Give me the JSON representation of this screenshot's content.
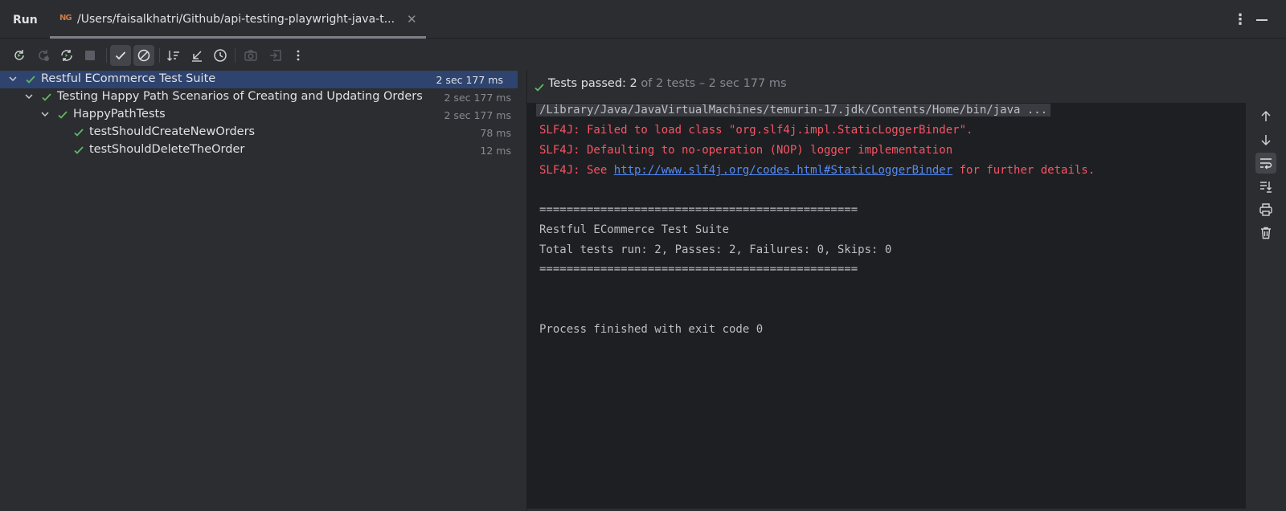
{
  "window": {
    "panel_title": "Run",
    "tab_title": "/Users/faisalkhatri/Github/api-testing-playwright-java-t...",
    "tab_icon_text": "NG"
  },
  "toolbar": {
    "buttons": [
      {
        "name": "rerun-icon"
      },
      {
        "name": "rerun-failed-icon"
      },
      {
        "name": "toggle-auto-test-icon"
      },
      {
        "name": "stop-icon"
      },
      {
        "name": "show-passed-icon",
        "active": true
      },
      {
        "name": "show-ignored-icon",
        "active": true
      },
      {
        "name": "sort-alphabetically-icon"
      },
      {
        "name": "collapse-all-icon"
      },
      {
        "name": "test-history-icon"
      },
      {
        "name": "camera-icon"
      },
      {
        "name": "import-tests-icon"
      },
      {
        "name": "more-options-icon"
      }
    ]
  },
  "tree": {
    "rows": [
      {
        "label": "Restful ECommerce Test Suite",
        "time": "2 sec 177 ms",
        "level": 0,
        "expandable": true,
        "selected": true
      },
      {
        "label": "Testing Happy Path Scenarios of Creating and Updating Orders",
        "time": "2 sec 177 ms",
        "level": 1,
        "expandable": true
      },
      {
        "label": "HappyPathTests",
        "time": "2 sec 177 ms",
        "level": 2,
        "expandable": true
      },
      {
        "label": "testShouldCreateNewOrders",
        "time": "78 ms",
        "level": 3,
        "expandable": false
      },
      {
        "label": "testShouldDeleteTheOrder",
        "time": "12 ms",
        "level": 3,
        "expandable": false
      }
    ]
  },
  "status": {
    "prefix": "Tests passed: ",
    "passed": "2",
    "suffix": " of 2 tests – 2 sec 177 ms"
  },
  "console": {
    "command": "/Library/Java/JavaVirtualMachines/temurin-17.jdk/Contents/Home/bin/java ...",
    "err1": "SLF4J: Failed to load class \"org.slf4j.impl.StaticLoggerBinder\".",
    "err2": "SLF4J: Defaulting to no-operation (NOP) logger implementation",
    "err3_prefix": "SLF4J: See ",
    "err3_link": "http://www.slf4j.org/codes.html#StaticLoggerBinder",
    "err3_suffix": " for further details.",
    "separator": "===============================================",
    "suite_name": "Restful ECommerce Test Suite",
    "summary": "Total tests run: 2, Passes: 2, Failures: 0, Skips: 0",
    "exit": "Process finished with exit code 0"
  },
  "colors": {
    "pass_green": "#5fb865",
    "error_red": "#f75464",
    "link_blue": "#548af7",
    "selection": "#2e436e"
  }
}
